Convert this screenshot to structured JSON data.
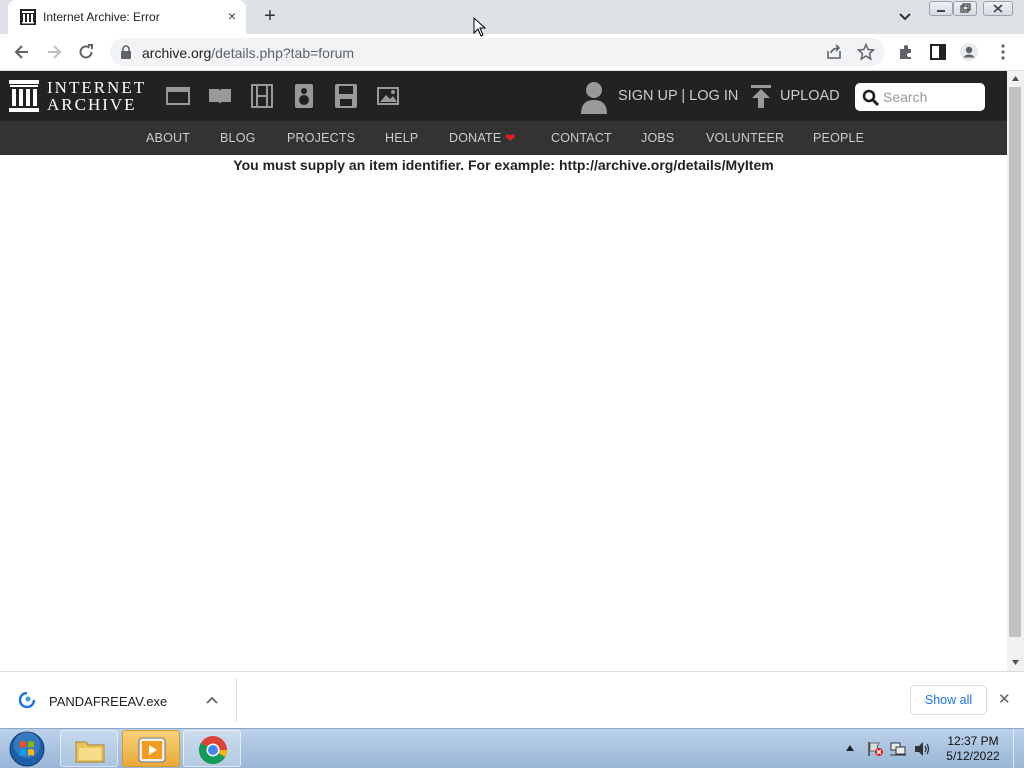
{
  "browser": {
    "tab": {
      "title": "Internet Archive: Error",
      "close_glyph": "×"
    },
    "new_tab_glyph": "+",
    "address": {
      "host": "archive.org",
      "path": "/details.php?tab=forum"
    }
  },
  "site": {
    "logo": {
      "line1": "INTERNET",
      "line2": "ARCHIVE"
    },
    "media_icons": [
      "web-icon",
      "texts-icon",
      "video-icon",
      "audio-icon",
      "software-icon",
      "images-icon"
    ],
    "user": {
      "signup_login": "SIGN UP | LOG IN"
    },
    "upload_label": "UPLOAD",
    "search": {
      "placeholder": "Search"
    },
    "nav": [
      "ABOUT",
      "BLOG",
      "PROJECTS",
      "HELP",
      "DONATE",
      "CONTACT",
      "JOBS",
      "VOLUNTEER",
      "PEOPLE"
    ],
    "donate_heart": "❤",
    "accent": "#e81c24"
  },
  "content": {
    "error_message": "You must supply an item identifier. For example: http://archive.org/details/MyItem"
  },
  "downloads": {
    "item_name": "PANDAFREEAV.exe",
    "show_all": "Show all",
    "close_glyph": "✕"
  },
  "taskbar": {
    "time": "12:37 PM",
    "date": "5/12/2022"
  }
}
